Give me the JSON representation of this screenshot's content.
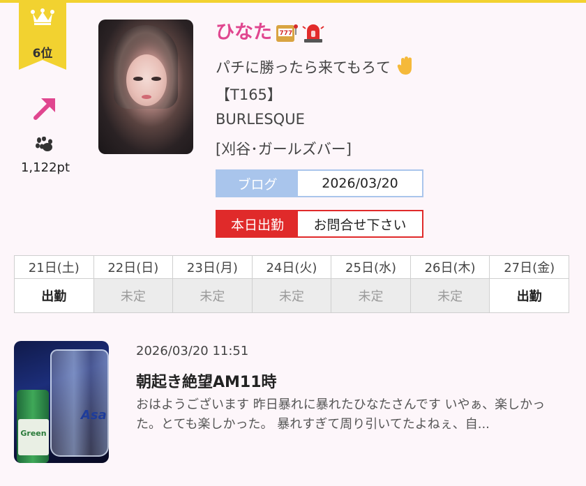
{
  "rank": {
    "label": "6位",
    "trend": "up",
    "points": "1,122pt"
  },
  "icons": {
    "crown": "crown-icon",
    "trend": "arrow-up-right-icon",
    "paw": "paw-icon"
  },
  "profile": {
    "name": "ひなた",
    "name_emojis": [
      "slot-machine-icon",
      "siren-icon"
    ],
    "catchphrase": "パチに勝ったら来てもろて",
    "catchphrase_emoji": "raised-hand-icon",
    "height": "【T165】",
    "shop": "BURLESQUE",
    "area": "[刈谷･ガールズバー]"
  },
  "tags": {
    "blog": {
      "label": "ブログ",
      "value": "2026/03/20"
    },
    "work": {
      "label": "本日出勤",
      "value": "お問合せ下さい"
    }
  },
  "schedule": {
    "days": [
      {
        "label": "21日(土)",
        "status": "出勤"
      },
      {
        "label": "22日(日)",
        "status": "未定"
      },
      {
        "label": "23日(月)",
        "status": "未定"
      },
      {
        "label": "24日(火)",
        "status": "未定"
      },
      {
        "label": "25日(水)",
        "status": "未定"
      },
      {
        "label": "26日(木)",
        "status": "未定"
      },
      {
        "label": "27日(金)",
        "status": "出勤"
      }
    ]
  },
  "blog_post": {
    "datetime": "2026/03/20 11:51",
    "title": "朝起き絶望AM11時",
    "excerpt": "おはようございます 昨日暴れに暴れたひなたさんです いやぁ、楽しかった。とても楽しかった。 暴れすぎて周り引いてたよねぇ、自...",
    "thumb_text": "Asa",
    "bottle_text": "Green"
  },
  "colors": {
    "accent_gold": "#f2d230",
    "name_pink": "#e0468f",
    "blog_blue": "#a9c5ec",
    "work_red": "#e02a2a",
    "saturday": "#3bb6c6",
    "sunday": "#ef6ea6"
  }
}
